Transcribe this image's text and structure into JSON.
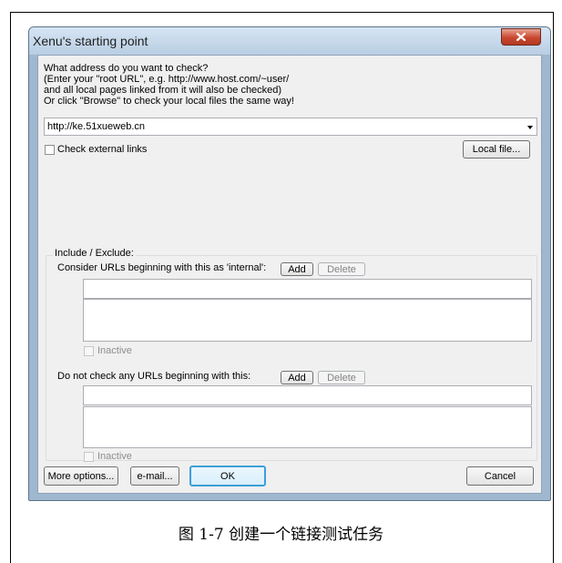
{
  "window": {
    "title": "Xenu's starting point",
    "close_icon": "close-icon"
  },
  "instructions": [
    "What address do you want to check?",
    "(Enter your \"root URL\", e.g. http://www.host.com/~user/",
    "and all local pages linked from it will also be checked)",
    "Or click \"Browse\" to check your local files the same way!"
  ],
  "url_field": {
    "value": "http://ke.51xueweb.cn"
  },
  "check_external": {
    "label": "Check external links",
    "checked": false
  },
  "local_file_button": "Local file...",
  "include_exclude": {
    "title": "Include / Exclude:",
    "internal": {
      "label": "Consider URLs beginning with this as 'internal':",
      "add": "Add",
      "delete": "Delete",
      "input_value": "",
      "inactive_label": "Inactive"
    },
    "exclude": {
      "label": "Do not check any URLs beginning with this:",
      "add": "Add",
      "delete": "Delete",
      "input_value": "",
      "inactive_label": "Inactive"
    }
  },
  "buttons": {
    "more_options": "More options...",
    "email": "e-mail...",
    "ok": "OK",
    "cancel": "Cancel"
  },
  "caption": "图 1-7  创建一个链接测试任务"
}
